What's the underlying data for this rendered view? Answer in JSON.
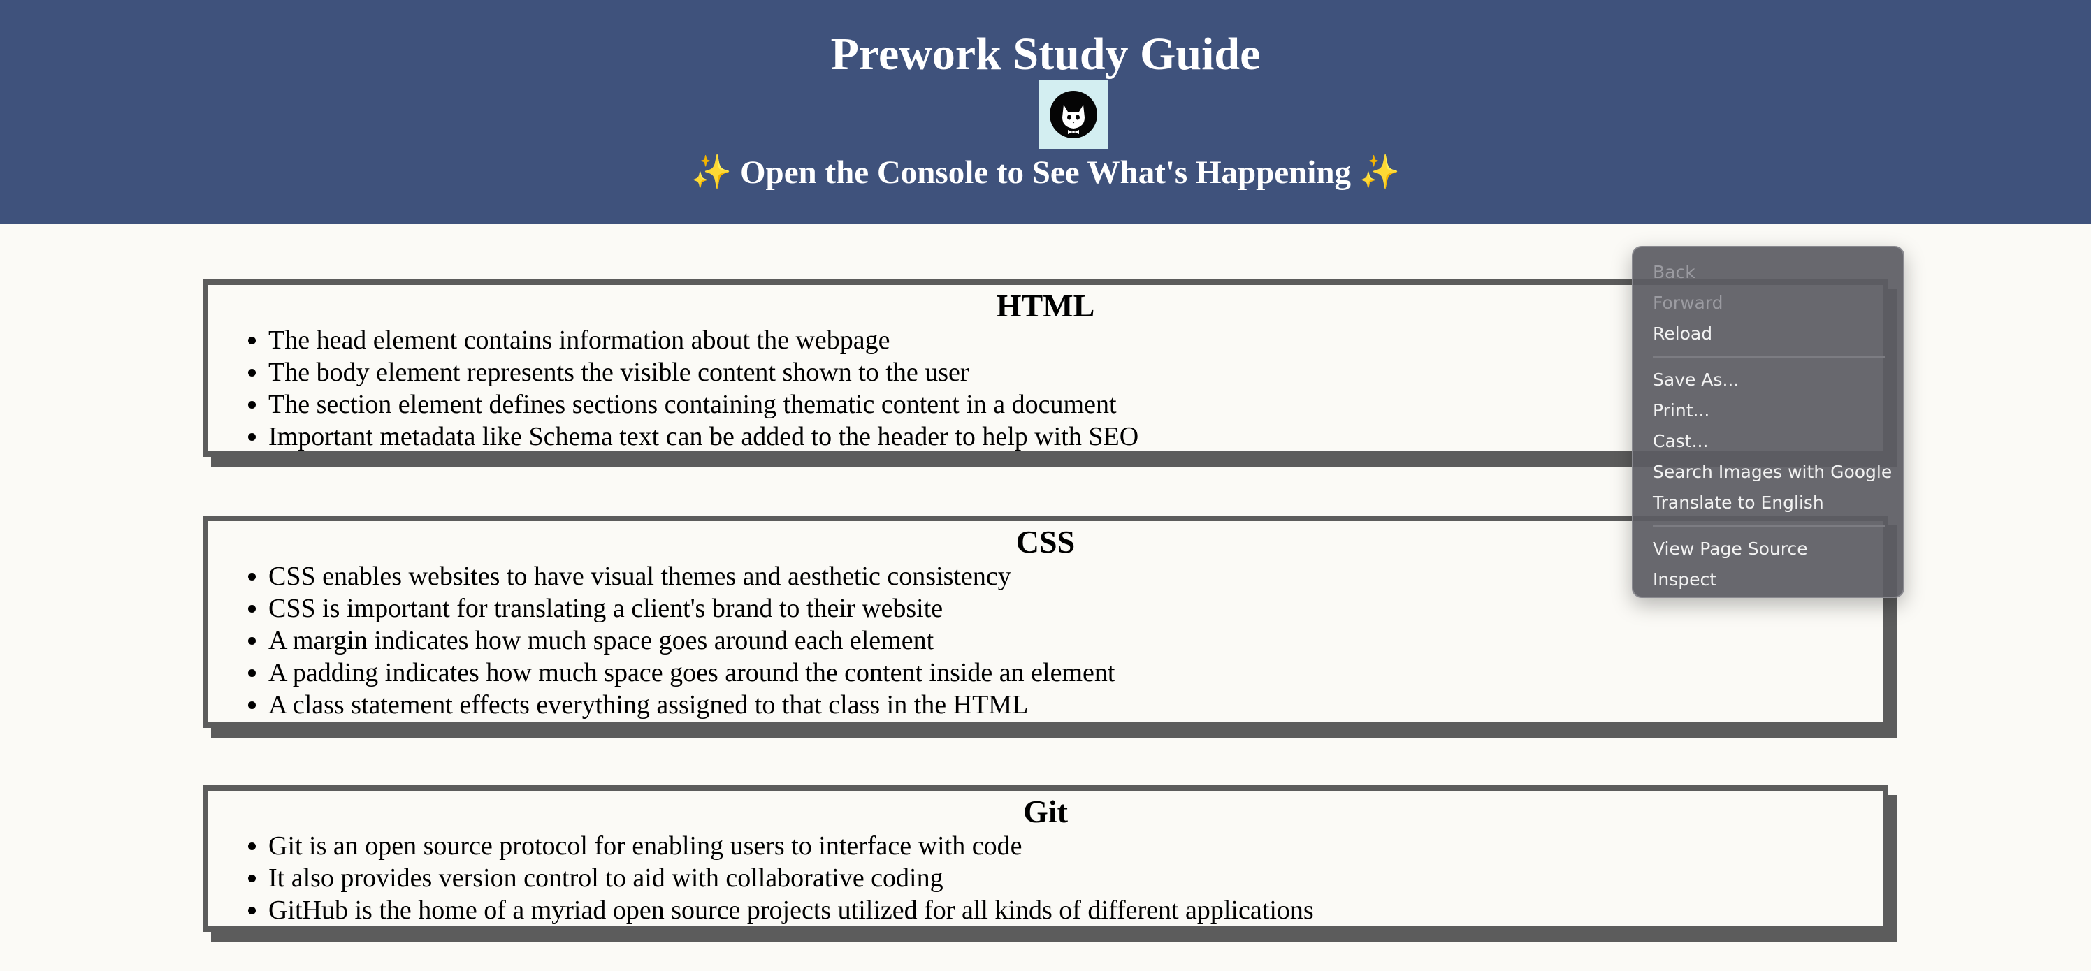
{
  "header": {
    "title": "Prework Study Guide",
    "logo_icon": "cat-logo-icon",
    "subtitle_text": "Open the Console to See What's Happening",
    "sparkle": "✨",
    "colors": {
      "background": "#3f527c",
      "logo_bg": "#d3eef1"
    }
  },
  "sections": {
    "html": {
      "title": "HTML",
      "items": [
        "The head element contains information about the webpage",
        "The body element represents the visible content shown to the user",
        "The section element defines sections containing thematic content in a document",
        "Important metadata like Schema text can be added to the header to help with SEO"
      ]
    },
    "css": {
      "title": "CSS",
      "items": [
        "CSS enables websites to have visual themes and aesthetic consistency",
        "CSS is important for translating a client's brand to their website",
        "A margin indicates how much space goes around each element",
        "A padding indicates how much space goes around the content inside an element",
        "A class statement effects everything assigned to that class in the HTML"
      ]
    },
    "git": {
      "title": "Git",
      "items": [
        "Git is an open source protocol for enabling users to interface with code",
        "It also provides version control to aid with collaborative coding",
        "GitHub is the home of a myriad open source projects utilized for all kinds of different applications"
      ]
    }
  },
  "context_menu": {
    "back": "Back",
    "forward": "Forward",
    "reload": "Reload",
    "save_as": "Save As...",
    "print": "Print...",
    "cast": "Cast...",
    "search_images": "Search Images with Google",
    "translate": "Translate to English",
    "view_source": "View Page Source",
    "inspect": "Inspect"
  },
  "colors": {
    "page_background": "#fbfaf6",
    "card_border": "#5c5c5c",
    "menu_background": "#5c5c63"
  }
}
